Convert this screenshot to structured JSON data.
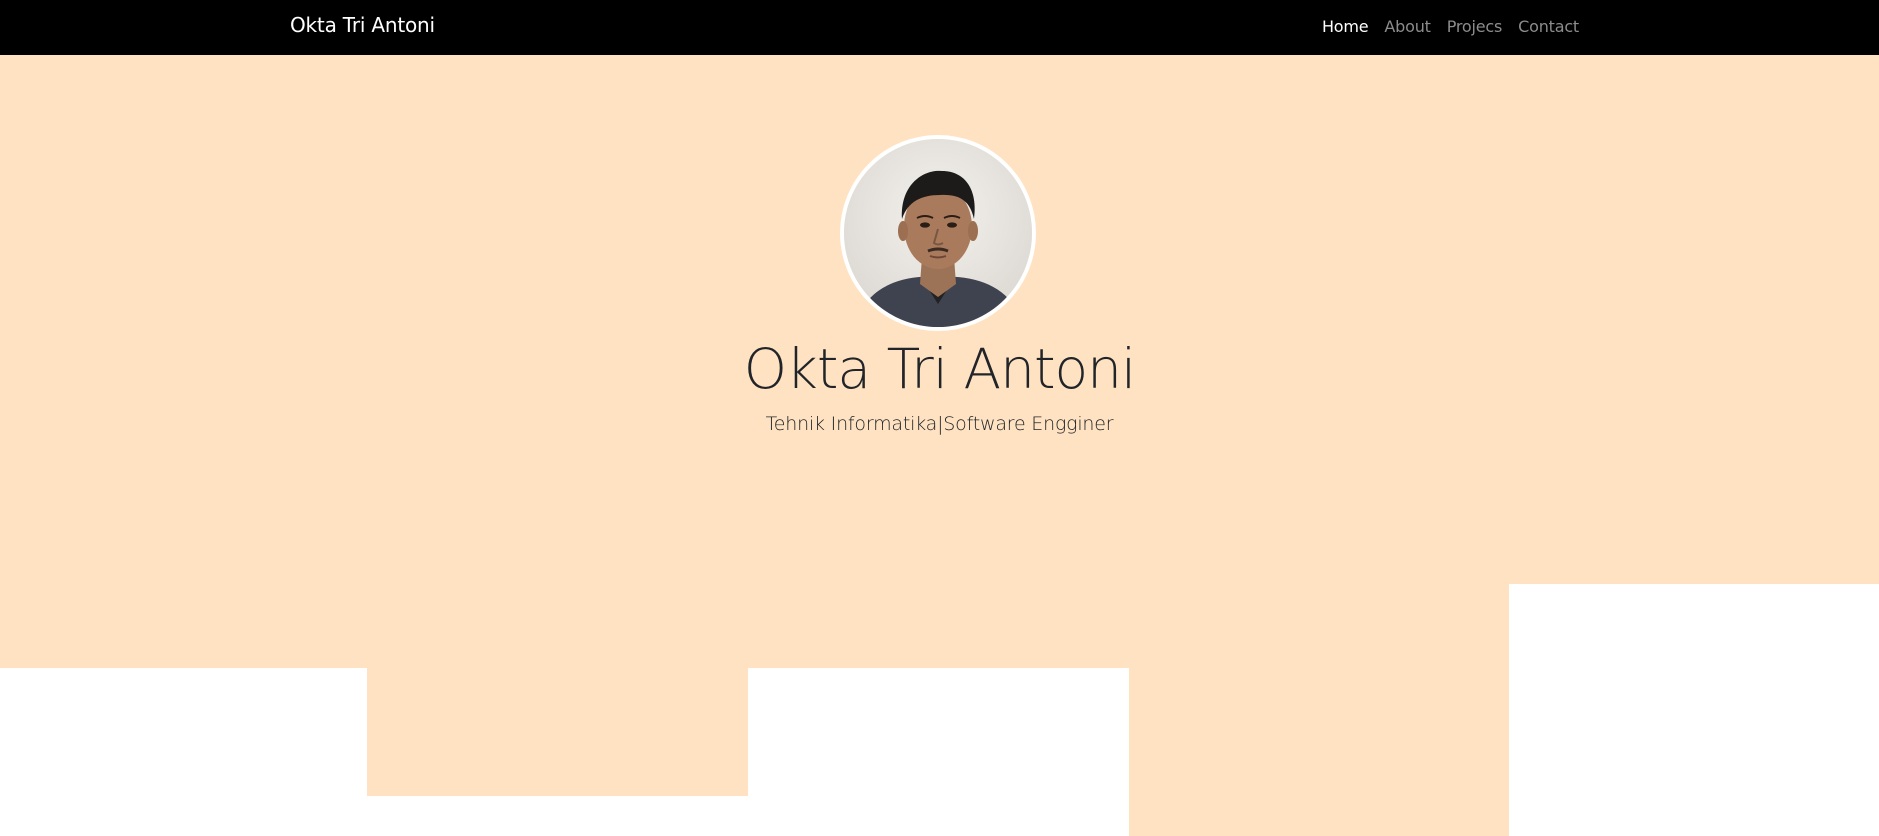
{
  "navbar": {
    "brand": "Okta Tri Antoni",
    "links": [
      {
        "label": "Home",
        "active": true
      },
      {
        "label": "About",
        "active": false
      },
      {
        "label": "Projecs",
        "active": false
      },
      {
        "label": "Contact",
        "active": false
      }
    ]
  },
  "hero": {
    "name": "Okta Tri Antoni",
    "subtitle": "Tehnik Informatika|Software Engginer",
    "avatar_alt": "profile-photo"
  },
  "colors": {
    "background": "#ffe2c2",
    "navbar": "#000000"
  }
}
